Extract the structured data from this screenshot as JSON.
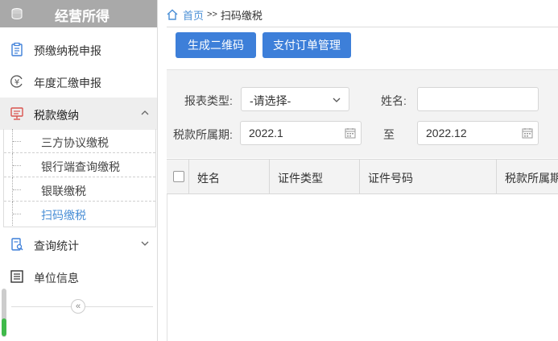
{
  "sidebar": {
    "title": "经营所得",
    "menu": [
      {
        "label": "预缴纳税申报",
        "icon": "clipboard-icon"
      },
      {
        "label": "年度汇缴申报",
        "icon": "yen-circle-icon"
      },
      {
        "label": "税款缴纳",
        "icon": "monitor-icon",
        "expanded": true
      },
      {
        "label": "查询统计",
        "icon": "report-search-icon"
      },
      {
        "label": "单位信息",
        "icon": "list-icon"
      }
    ],
    "submenu": [
      "三方协议缴税",
      "银行端查询缴税",
      "银联缴税",
      "扫码缴税"
    ],
    "collapse": "«"
  },
  "breadcrumb": {
    "home": "首页",
    "sep": ">>",
    "current": "扫码缴税"
  },
  "toolbar": {
    "qr_button": "生成二维码",
    "orders_button": "支付订单管理"
  },
  "filters": {
    "report_type_label": "报表类型:",
    "report_type_value": "-请选择-",
    "name_label": "姓名:",
    "name_value": "",
    "period_label": "税款所属期:",
    "period_from": "2022.1",
    "to_label": "至",
    "period_to": "2022.12"
  },
  "table": {
    "columns": [
      "姓名",
      "证件类型",
      "证件号码",
      "税款所属期"
    ]
  },
  "colors": {
    "accent": "#3d7fd9",
    "link": "#4a8fd6",
    "header_bg": "#a9a9a9"
  }
}
